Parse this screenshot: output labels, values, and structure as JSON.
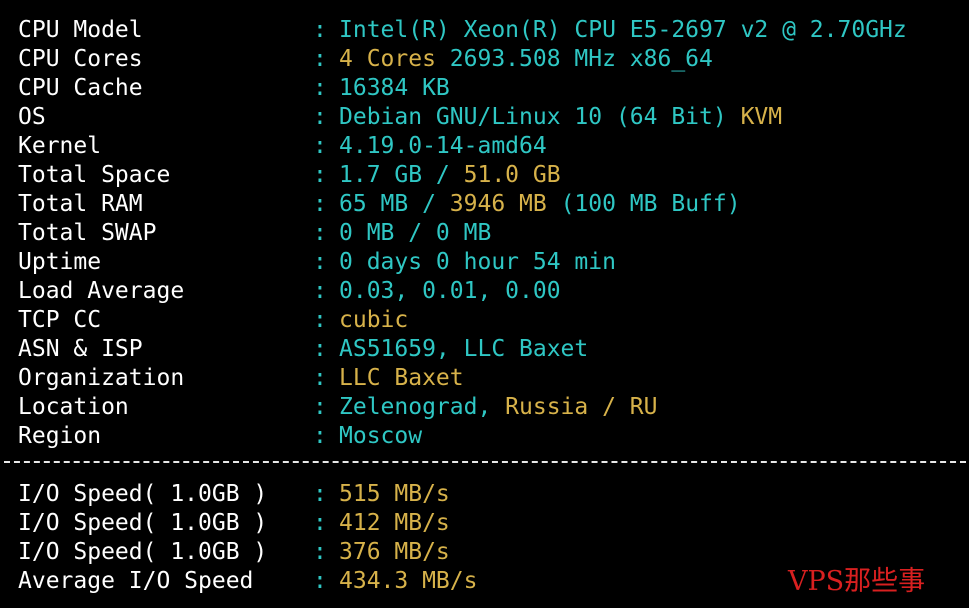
{
  "system_info": [
    {
      "label": "CPU Model",
      "parts": [
        {
          "text": "Intel(R) Xeon(R) CPU E5-2697 v2 @ 2.70GHz",
          "color": "cyan"
        }
      ]
    },
    {
      "label": "CPU Cores",
      "parts": [
        {
          "text": "4 Cores ",
          "color": "gold"
        },
        {
          "text": "2693.508 MHz x86_64",
          "color": "cyan"
        }
      ]
    },
    {
      "label": "CPU Cache",
      "parts": [
        {
          "text": "16384 KB",
          "color": "cyan"
        }
      ]
    },
    {
      "label": "OS",
      "parts": [
        {
          "text": "Debian GNU/Linux 10 (64 Bit) ",
          "color": "cyan"
        },
        {
          "text": "KVM",
          "color": "gold"
        }
      ]
    },
    {
      "label": "Kernel",
      "parts": [
        {
          "text": "4.19.0-14-amd64",
          "color": "cyan"
        }
      ]
    },
    {
      "label": "Total Space",
      "parts": [
        {
          "text": "1.7 GB / ",
          "color": "cyan"
        },
        {
          "text": "51.0 GB",
          "color": "gold"
        }
      ]
    },
    {
      "label": "Total RAM",
      "parts": [
        {
          "text": "65 MB / ",
          "color": "cyan"
        },
        {
          "text": "3946 MB",
          "color": "gold"
        },
        {
          "text": " (100 MB Buff)",
          "color": "cyan"
        }
      ]
    },
    {
      "label": "Total SWAP",
      "parts": [
        {
          "text": "0 MB / 0 MB",
          "color": "cyan"
        }
      ]
    },
    {
      "label": "Uptime",
      "parts": [
        {
          "text": "0 days 0 hour 54 min",
          "color": "cyan"
        }
      ]
    },
    {
      "label": "Load Average",
      "parts": [
        {
          "text": "0.03, 0.01, 0.00",
          "color": "cyan"
        }
      ]
    },
    {
      "label": "TCP CC",
      "parts": [
        {
          "text": "cubic",
          "color": "gold"
        }
      ]
    },
    {
      "label": "ASN & ISP",
      "parts": [
        {
          "text": "AS51659, LLC Baxet",
          "color": "cyan"
        }
      ]
    },
    {
      "label": "Organization",
      "parts": [
        {
          "text": "LLC Baxet",
          "color": "gold"
        }
      ]
    },
    {
      "label": "Location",
      "parts": [
        {
          "text": "Zelenograd, ",
          "color": "cyan"
        },
        {
          "text": "Russia / RU",
          "color": "gold"
        }
      ]
    },
    {
      "label": "Region",
      "parts": [
        {
          "text": "Moscow",
          "color": "cyan"
        }
      ]
    }
  ],
  "io_info": [
    {
      "label": "I/O Speed( 1.0GB )",
      "parts": [
        {
          "text": "515 MB/s",
          "color": "gold"
        }
      ]
    },
    {
      "label": "I/O Speed( 1.0GB )",
      "parts": [
        {
          "text": "412 MB/s",
          "color": "gold"
        }
      ]
    },
    {
      "label": "I/O Speed( 1.0GB )",
      "parts": [
        {
          "text": "376 MB/s",
          "color": "gold"
        }
      ]
    },
    {
      "label": "Average I/O Speed",
      "parts": [
        {
          "text": "434.3 MB/s",
          "color": "gold"
        }
      ]
    }
  ],
  "separator_char": ":",
  "watermark": "VPS那些事",
  "colors": {
    "background": "#000000",
    "label": "#ffffff",
    "cyan": "#2fc7c4",
    "gold": "#d7b24a",
    "watermark": "#d92020"
  }
}
